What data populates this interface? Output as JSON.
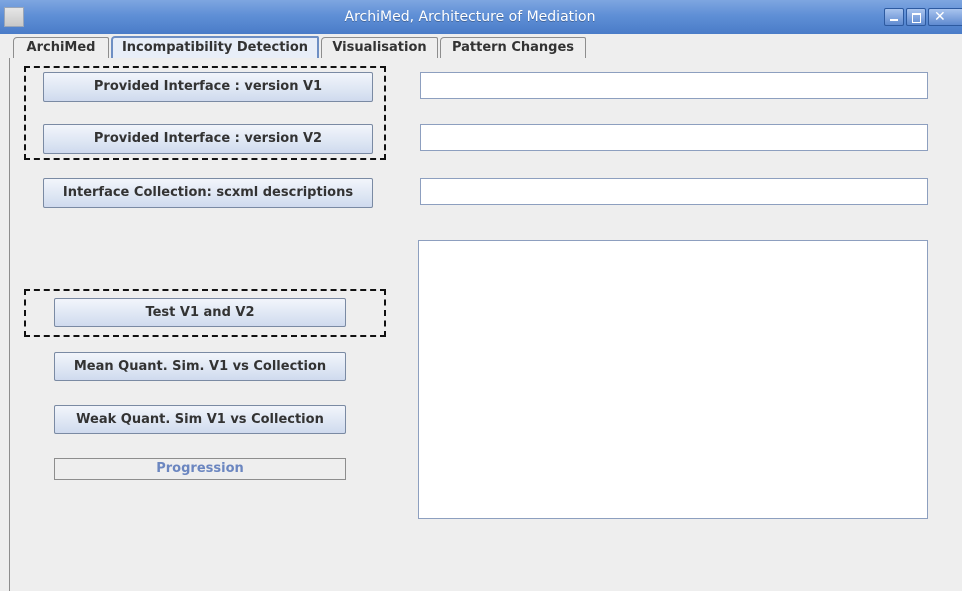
{
  "window": {
    "title": "ArchiMed, Architecture of Mediation"
  },
  "icons": {
    "app": "app-icon",
    "minimize": "minimize-icon",
    "maximize": "maximize-icon",
    "close": "close-icon"
  },
  "tabs": [
    {
      "label": "ArchiMed",
      "selected": false
    },
    {
      "label": "Incompatibility Detection",
      "selected": true
    },
    {
      "label": "Visualisation",
      "selected": false
    },
    {
      "label": "Pattern Changes",
      "selected": false
    }
  ],
  "buttons": {
    "provided_v1": "Provided Interface : version V1",
    "provided_v2": "Provided Interface : version V2",
    "collection": "Interface Collection: scxml descriptions",
    "test": "Test V1 and V2",
    "mean": "Mean Quant. Sim. V1 vs Collection",
    "weak": "Weak Quant. Sim V1 vs Collection"
  },
  "progress": {
    "label": "Progression",
    "value": 0
  },
  "fields": {
    "v1_path": "",
    "v2_path": "",
    "collection_path": "",
    "results": ""
  },
  "colors": {
    "titlebar": "#5f8fd6",
    "selected_tab": "#6e8fc4",
    "progress_text": "#6b86c0"
  }
}
